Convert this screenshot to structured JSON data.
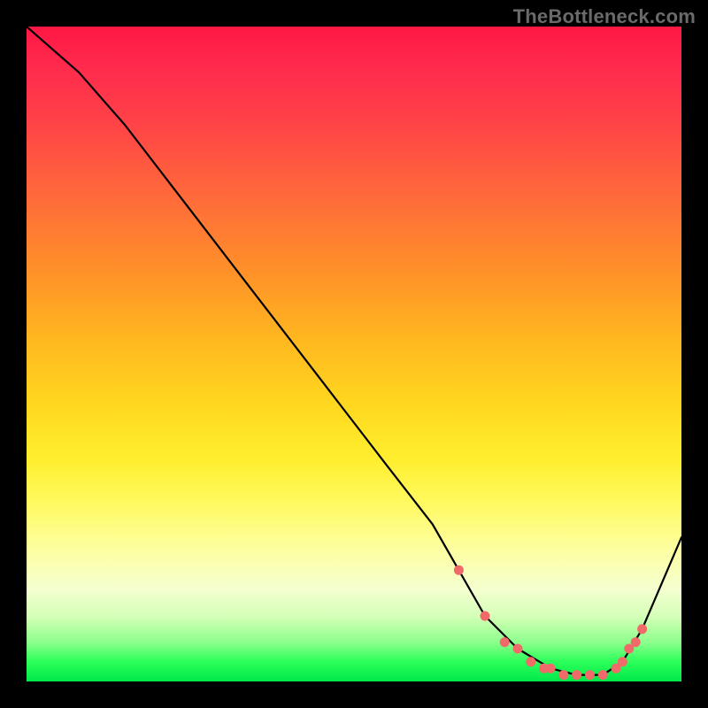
{
  "watermark": "TheBottleneck.com",
  "colors": {
    "background": "#000000",
    "watermark": "#6a6a6a",
    "curve": "#000000",
    "marker": "#f06a6a",
    "gradient_stops": [
      "#ff1744",
      "#ff6a3a",
      "#ffd81f",
      "#fdffa2",
      "#00e84a"
    ]
  },
  "chart_data": {
    "type": "line",
    "title": "",
    "xlabel": "",
    "ylabel": "",
    "xlim": [
      0,
      100
    ],
    "ylim": [
      0,
      100
    ],
    "grid": false,
    "legend": false,
    "series": [
      {
        "name": "bottleneck-curve",
        "x": [
          0,
          8,
          15,
          25,
          35,
          45,
          55,
          62,
          66,
          70,
          75,
          80,
          84,
          88,
          91,
          94,
          100
        ],
        "values": [
          100,
          93,
          85,
          72,
          59,
          46,
          33,
          24,
          17,
          10,
          5,
          2,
          1,
          1,
          3,
          8,
          22
        ]
      }
    ],
    "markers": {
      "name": "highlight-points",
      "x": [
        66,
        70,
        73,
        75,
        77,
        79,
        80,
        82,
        84,
        86,
        88,
        90,
        91,
        92,
        93,
        94
      ],
      "values": [
        17,
        10,
        6,
        5,
        3,
        2,
        2,
        1,
        1,
        1,
        1,
        2,
        3,
        5,
        6,
        8
      ]
    },
    "gradient_description": "vertical red-to-green, value encodes y (top=high/red=bad, bottom=low/green=good)"
  }
}
